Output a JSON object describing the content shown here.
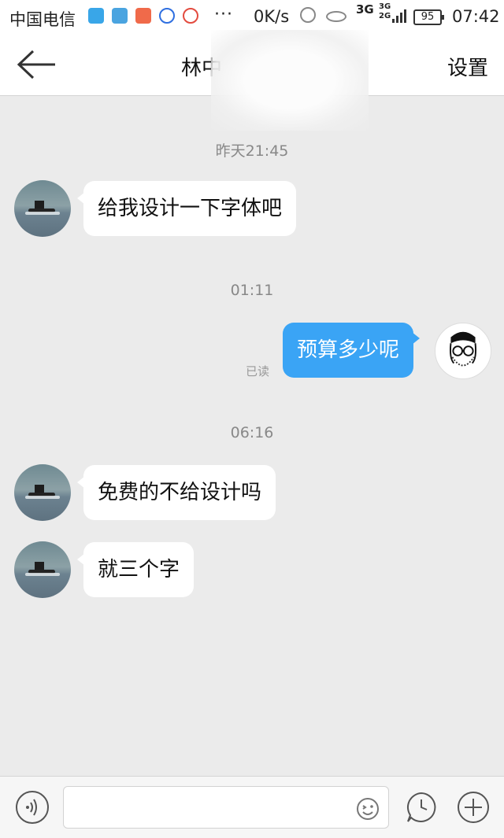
{
  "status_bar": {
    "carrier": "中国电信",
    "more": "···",
    "speed": "0K/s",
    "net_type": "3G",
    "net_type_2a": "3G",
    "net_type_2b": "2G",
    "battery": "95",
    "time": "07:42"
  },
  "header": {
    "title": "林中",
    "settings_label": "设置"
  },
  "messages": [
    {
      "timestamp": "昨天21:45",
      "side": "left",
      "text": "给我设计一下字体吧"
    },
    {
      "timestamp": "01:11",
      "side": "right",
      "text": "预算多少呢",
      "read_label": "已读"
    },
    {
      "timestamp": "06:16",
      "side": "left",
      "text": "免费的不给设计吗"
    },
    {
      "side": "left",
      "text": "就三个字"
    }
  ],
  "input": {
    "value": "",
    "placeholder": ""
  },
  "colors": {
    "sent_bubble": "#3aa4f5",
    "chat_background": "#ebebeb"
  }
}
